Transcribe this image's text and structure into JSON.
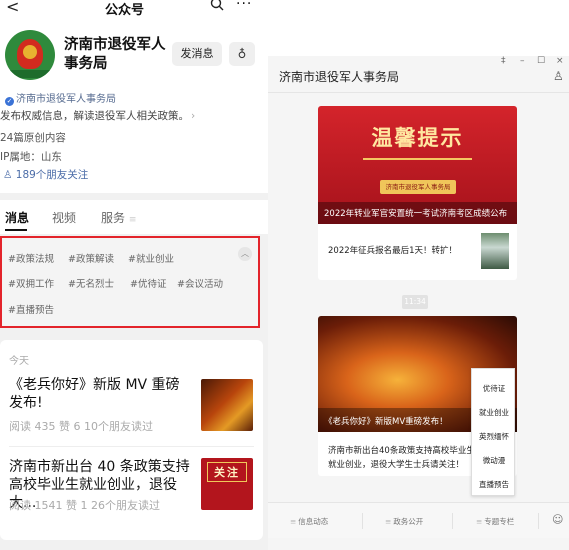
{
  "mobile": {
    "nav": {
      "back": "<",
      "title": "公众号",
      "more": "···"
    },
    "profile": {
      "name": "济南市退役军人事务局",
      "message_button": "发消息",
      "person_button": "♁",
      "verified_text": "济南市退役军人事务局",
      "description": "发布权威信息，解读退役军人相关政策。",
      "original_count": "24篇原创内容",
      "ip_location": "IP属地：山东",
      "friends_following": "189个朋友关注"
    },
    "tabs": [
      {
        "label": "消息",
        "active": true
      },
      {
        "label": "视频",
        "active": false
      },
      {
        "label": "服务",
        "active": false
      }
    ],
    "tags": [
      "#政策法规",
      "#政策解读",
      "#就业创业",
      "#双拥工作",
      "#无名烈士",
      "#优待证",
      "#会议活动",
      "#直播预告"
    ],
    "feed": {
      "today": "今天",
      "article1": {
        "title": "《老兵你好》新版 MV 重磅发布!",
        "meta": "阅读 435  赞 6  10个朋友读过"
      },
      "article2": {
        "title": "济南市新出台 40 条政策支持高校毕业生就业创业，退役大...",
        "meta": "阅读 1541  赞 1  26个朋友读过",
        "thumb_label": "关注"
      }
    }
  },
  "desktop": {
    "window_controls": {
      "pin": "‡",
      "minimize": "–",
      "maximize": "☐",
      "close": "×"
    },
    "title": "济南市退役军人事务局",
    "message1": {
      "banner_title": "温馨提示",
      "banner_badge": "济南市退役军人事务局",
      "banner_caption": "2022年转业军官安置统一考试济南考区成绩公布",
      "item_title": "2022年征兵报名最后1天！转扩！"
    },
    "timestamp": "11:34",
    "message2": {
      "image_caption": "《老兵你好》新版MV重磅发布！",
      "text": "济南市新出台40条政策支持高校毕业生就业创业，退役大学生士兵请关注！"
    },
    "popup_menu": [
      "优待证",
      "就业创业",
      "英烈缅怀",
      "微动漫",
      "直播预告"
    ],
    "bottom_menu": [
      "信息动态",
      "政务公开",
      "专题专栏"
    ]
  }
}
